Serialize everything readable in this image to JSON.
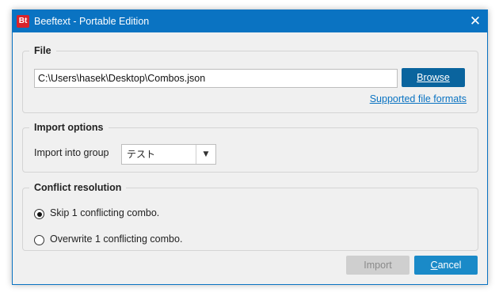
{
  "window": {
    "app_icon_text": "Bt",
    "title": "Beeftext - Portable Edition",
    "close_glyph": "✕"
  },
  "file_group": {
    "legend": "File",
    "path_value": "C:\\Users\\hasek\\Desktop\\Combos.json",
    "browse_label": "Browse",
    "formats_link": "Supported file formats"
  },
  "import_options": {
    "legend": "Import options",
    "group_label": "Import into group",
    "group_value": "テスト",
    "dropdown_glyph": "▼"
  },
  "conflict": {
    "legend": "Conflict resolution",
    "options": [
      {
        "label": "Skip 1 conflicting combo.",
        "checked": true
      },
      {
        "label": "Overwrite 1 conflicting combo.",
        "checked": false
      }
    ]
  },
  "buttons": {
    "import_label": "Import",
    "import_enabled": false,
    "cancel_mnemonic": "C",
    "cancel_rest": "ancel"
  },
  "colors": {
    "accent": "#0a73c2",
    "browse_bg": "#0a649e",
    "cancel_bg": "#1a8ac8",
    "disabled_bg": "#cfcfcf",
    "app_icon_bg": "#d9232a"
  },
  "icons": {
    "app": "beeftext-app-icon",
    "close": "close-icon",
    "dropdown": "chevron-down-icon"
  }
}
